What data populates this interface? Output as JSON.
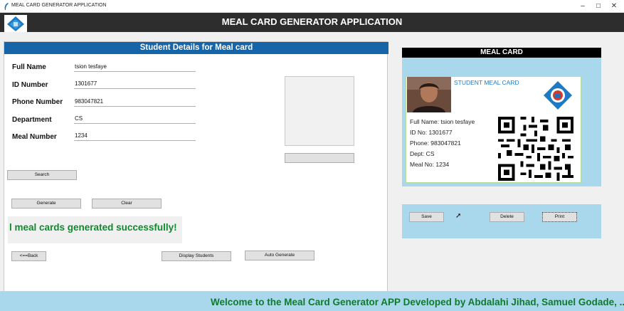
{
  "window": {
    "title": "MEAL CARD GENERATOR APPLICATION",
    "controls": {
      "minimize": "–",
      "maximize": "□",
      "close": "✕"
    }
  },
  "banner": {
    "title": "MEAL CARD GENERATOR APPLICATION"
  },
  "form": {
    "header": "Student Details for Meal card",
    "fields": [
      {
        "label": "Full Name",
        "value": "tsion tesfaye"
      },
      {
        "label": "ID Number",
        "value": "1301677"
      },
      {
        "label": "Phone Number",
        "value": "983047821"
      },
      {
        "label": "Department",
        "value": "CS"
      },
      {
        "label": "Meal Number",
        "value": "1234"
      }
    ],
    "buttons": {
      "upload": "",
      "search": "Search",
      "generate": "Generate",
      "clear": "Clear",
      "back": "<==Back",
      "display_students": "Display Students",
      "auto_generate": "Auto Generate"
    },
    "status": "l meal cards generated successfully!"
  },
  "card_panel": {
    "title": "MEAL CARD",
    "card": {
      "heading": "STUDENT MEAL CARD",
      "lines": [
        "Full Name: tsion tesfaye",
        "ID No: 1301677",
        "Phone: 983047821",
        "Dept: CS",
        "Meal No: 1234"
      ]
    }
  },
  "actions": {
    "save": "Save",
    "delete": "Delete",
    "print": "Print"
  },
  "footer": {
    "marquee": "Welcome to the Meal Card Generator APP Developed by Abdalahi Jihad, Samuel Godade, ..."
  },
  "colors": {
    "header_blue": "#1565a8",
    "panel_blue": "#a9d8ed",
    "success_green": "#0f8a2e",
    "banner_dark": "#2d2d2d"
  }
}
